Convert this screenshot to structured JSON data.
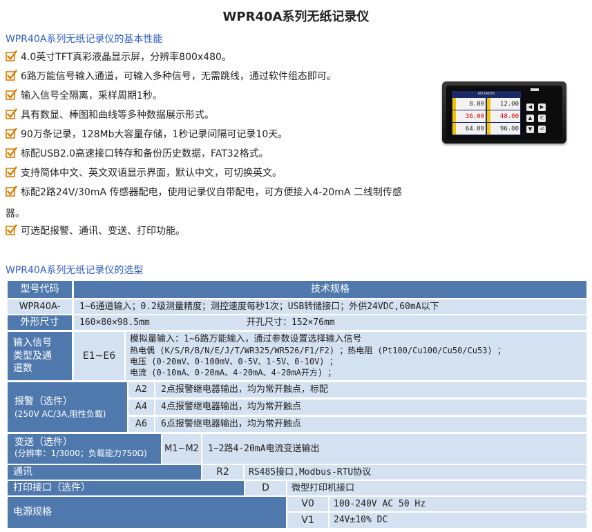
{
  "title": "WPR40A系列无纸记录仪",
  "section1": "WPR40A系列无纸记录仪的基本性能",
  "features": [
    "4.0英寸TFT真彩液晶显示屏，分辨率800x480。",
    "6路万能信号输入通道，可输入多种信号，无需跳线，通过软件组态即可。",
    "输入信号全隔离，采样周期1秒。",
    "具有数显、棒图和曲线等多种数据展示形式。",
    "90万条记录，128Mb大容量存储，1秒记录间隔可记录10天。",
    "标配USB2.0高速接口转存和备份历史数据，FAT32格式。",
    "支持简体中文、英文双语显示界面，默认中文，可切换英文。",
    "标配2路24V/30mA 传感器配电，使用记录仪自带配电，可方便接入4-20mA 二线制传感",
    "可选配报警、通讯、变送、打印功能。"
  ],
  "feature_wrap": "器。",
  "device": {
    "header": "RECORDER",
    "readings": [
      "8.00",
      "12.00",
      "36.00",
      "48.00",
      "64.00",
      "96.00"
    ],
    "keys": [
      "◀",
      "▶",
      "▲",
      "C",
      "▼",
      "⏎"
    ]
  },
  "section2": "WPR40A系列无纸记录仪的选型",
  "table": {
    "h_model": "型号代码",
    "h_spec": "技术规格",
    "model": "WPR40A-",
    "model_desc": "1~6通道输入；0.2级测量精度；测控速度每秒1次；USB转储接口；外供24VDC,60mA以下",
    "dim_label": "外形尺寸",
    "dim_value": "160×80×98.5mm",
    "cut_value": "开孔尺寸：152×76mm",
    "input_label": "输入信号类型及通道数",
    "input_code": "E1~E6",
    "input_lines": [
      "模拟量输入：1~6路万能输入，通过参数设置选择输入信号",
      "热电偶 (K/S/R/B/N/E/J/T/WR325/WR526/F1/F2) ；热电阻 (Pt100/Cu100/Cu50/Cu53) ；",
      "电压 (0-20mV、0-100mV、0-5V、1-5V、0-10V) ；",
      "电流 (0-10mA、0-20mA、4-20mA、4-20mA开方) ；"
    ],
    "alarm_label": "报警（选件）",
    "alarm_sub": "(250V AC/3A,阻性负载)",
    "alarm_rows": [
      {
        "code": "A2",
        "desc": "2点报警继电器输出，均为常开触点，标配"
      },
      {
        "code": "A4",
        "desc": "4点报警继电器输出，均为常开触点"
      },
      {
        "code": "A6",
        "desc": "6点报警继电器输出，均为常开触点"
      }
    ],
    "trans_label": "变送（选件）",
    "trans_sub": "(分辨率：1/3000；负载能力750Ω)",
    "trans_code": "M1~M2",
    "trans_desc": "1~2路4-20mA电流变送输出",
    "comm_label": "通讯",
    "comm_code": "R2",
    "comm_desc": "RS485接口,Modbus-RTU协议",
    "print_label": "打印接口（选件）",
    "print_code": "D",
    "print_desc": "微型打印机接口",
    "power_label": "电源规格",
    "power_rows": [
      {
        "code": "V0",
        "desc": "100-240V AC 50 Hz"
      },
      {
        "code": "V1",
        "desc": "24V±10% DC"
      }
    ]
  }
}
